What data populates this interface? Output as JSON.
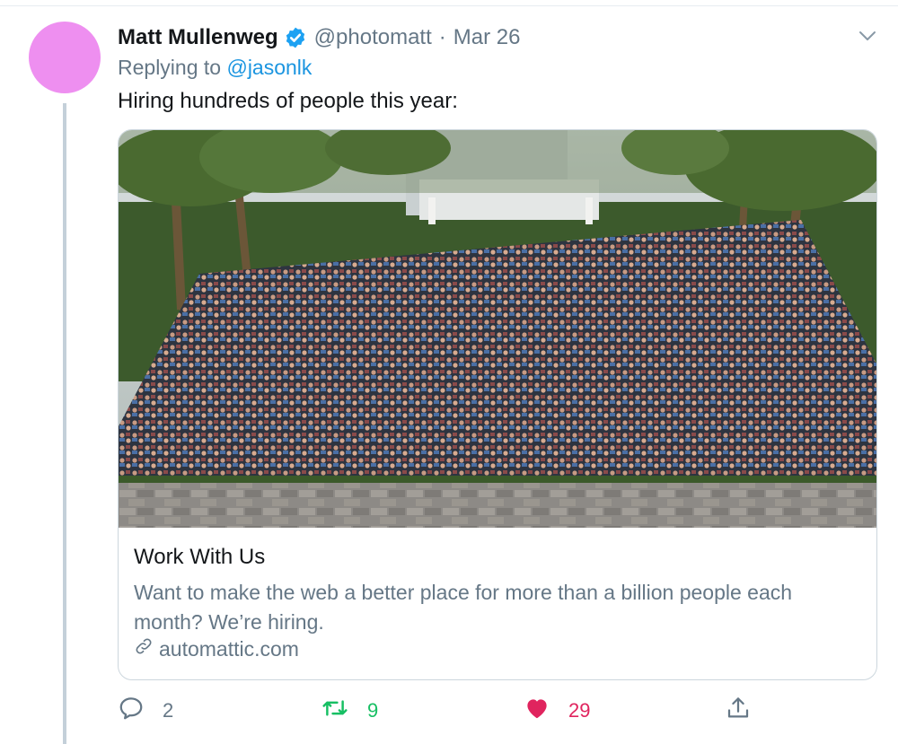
{
  "tweet": {
    "author_name": "Matt Mullenweg",
    "handle": "@photomatt",
    "separator": "·",
    "date": "Mar 26",
    "replying_prefix": "Replying to",
    "replying_to": "@jasonlk",
    "text": "Hiring hundreds of people this year:",
    "avatar_color": "#ee8ff0"
  },
  "card": {
    "title": "Work With Us",
    "description": "Want to make the web a better place for more than a billion people each month? We’re hiring.",
    "domain": "automattic.com",
    "image_icon": "group-photo"
  },
  "actions": {
    "reply_count": "2",
    "retweet_count": "9",
    "like_count": "29"
  },
  "colors": {
    "link": "#1b95e0",
    "secondary": "#657786",
    "retweet": "#17bf63",
    "like": "#e0245e",
    "verified": "#1da1f2"
  },
  "icons": [
    "verified-badge-icon",
    "chevron-down-icon",
    "link-icon",
    "reply-icon",
    "retweet-icon",
    "like-heart-icon",
    "share-icon"
  ]
}
